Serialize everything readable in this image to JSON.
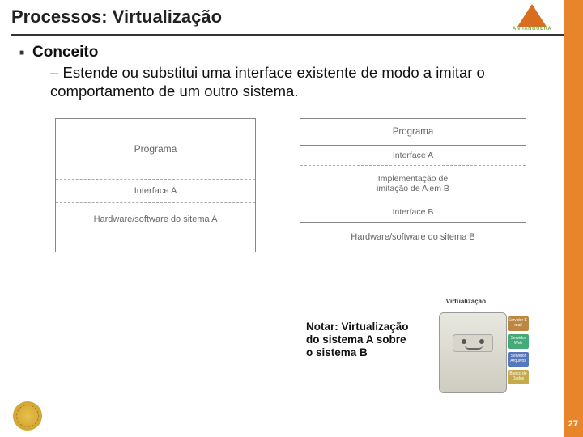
{
  "header": {
    "title": "Processos: Virtualização",
    "brand": "ANHANGUERA"
  },
  "content": {
    "concept_label": "Conceito",
    "concept_desc": "– Estende ou substitui uma interface existente de modo a imitar o comportamento de um outro sistema."
  },
  "diagramA": {
    "r1": "Programa",
    "r2": "Interface A",
    "r3": "Hardware/software do sitema A"
  },
  "diagramB": {
    "r1": "Programa",
    "r2": "Interface A",
    "r3": "Implementação de\nimitação de A em B",
    "r4": "Interface B",
    "r5": "Hardware/software do sitema B"
  },
  "virt_caption": "Virtualização",
  "note": "Notar: Virtualização do sistema A sobre o sistema B",
  "server_slots": {
    "s1": "Servidor E-mail",
    "s2": "Servidor Web",
    "s3": "Servidor Arquivos",
    "s4": "Banco de Dados"
  },
  "page_number": "27"
}
